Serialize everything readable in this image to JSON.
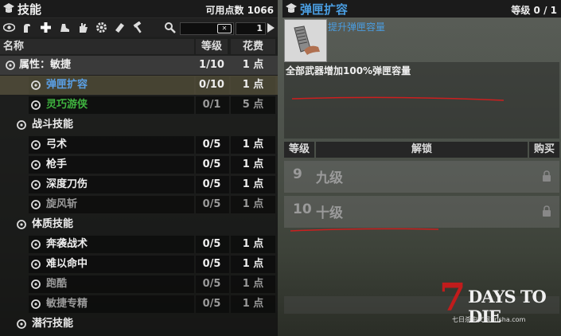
{
  "left_panel": {
    "title": "技能",
    "points_label": "可用点数 1066",
    "search": {
      "placeholder": ""
    },
    "page": "1",
    "columns": {
      "name": "名称",
      "level": "等级",
      "cost": "花费"
    },
    "rows": [
      {
        "name": "属性：敏捷",
        "level": "1/10",
        "cost": "1 点",
        "type": "attribute"
      },
      {
        "name": "弹匣扩容",
        "level": "0/10",
        "cost": "1 点",
        "type": "perk-selected"
      },
      {
        "name": "灵巧游侠",
        "level": "0/1",
        "cost": "5 点",
        "type": "perk-green"
      },
      {
        "name": "战斗技能",
        "type": "category"
      },
      {
        "name": "弓术",
        "level": "0/5",
        "cost": "1 点",
        "type": "perk"
      },
      {
        "name": "枪手",
        "level": "0/5",
        "cost": "1 点",
        "type": "perk"
      },
      {
        "name": "深度刀伤",
        "level": "0/5",
        "cost": "1 点",
        "type": "perk"
      },
      {
        "name": "旋风斩",
        "level": "0/5",
        "cost": "1 点",
        "type": "perk-dim"
      },
      {
        "name": "体质技能",
        "type": "category"
      },
      {
        "name": "奔袭战术",
        "level": "0/5",
        "cost": "1 点",
        "type": "perk"
      },
      {
        "name": "难以命中",
        "level": "0/5",
        "cost": "1 点",
        "type": "perk"
      },
      {
        "name": "跑酷",
        "level": "0/5",
        "cost": "1 点",
        "type": "perk-dim"
      },
      {
        "name": "敏捷专精",
        "level": "0/5",
        "cost": "1 点",
        "type": "perk-dim"
      },
      {
        "name": "潜行技能",
        "type": "category"
      }
    ]
  },
  "right_panel": {
    "title": "弹匣扩容",
    "level_label": "等级 0 / 1",
    "subtitle": "提升弹匣容量",
    "description": "全部武器增加100%弹匣容量",
    "table_headers": {
      "level": "等级",
      "unlock": "解锁",
      "buy": "购买"
    },
    "rows": [
      {
        "num": "9",
        "text": "九级"
      },
      {
        "num": "10",
        "text": "十级"
      }
    ]
  },
  "watermark": {
    "seven": "7",
    "name": "DAYS TO DIE",
    "site": "七日杀中文网7risha.com"
  },
  "colors": {
    "accent_blue": "#4a9de0",
    "selected_text": "#5aa0e6",
    "green_text": "#3fb43f",
    "dim_text": "#9a9a9a",
    "red_line": "#cc1f1f",
    "logo_red": "#c01c1c"
  },
  "icons": [
    "hat-icon",
    "eye-icon",
    "arm-icon",
    "plus-icon",
    "foot-icon",
    "hand-icon",
    "gear-icon",
    "book-icon",
    "hammer-icon",
    "search-icon",
    "clear-icon",
    "arrow-right-icon"
  ]
}
